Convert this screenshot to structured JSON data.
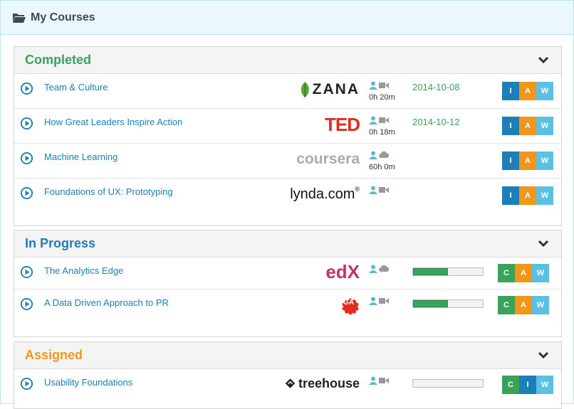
{
  "panel": {
    "title": "My Courses"
  },
  "colors": {
    "completed": "#3aa35b",
    "in_progress": "#1d7fb8",
    "assigned": "#f2961b",
    "link": "#1c7fb6"
  },
  "sections": {
    "completed": {
      "title": "Completed",
      "rows": [
        {
          "name": "Team & Culture",
          "provider": "ZANA",
          "media": [
            "person-icon",
            "video-icon"
          ],
          "duration": "0h 20m",
          "date": "2014-10-08",
          "badges": [
            "I",
            "A",
            "W"
          ]
        },
        {
          "name": "How Great Leaders Inspire Action",
          "provider": "TED",
          "media": [
            "person-icon",
            "video-icon"
          ],
          "duration": "0h 18m",
          "date": "2014-10-12",
          "badges": [
            "I",
            "A",
            "W"
          ]
        },
        {
          "name": "Machine Learning",
          "provider": "coursera",
          "media": [
            "person-icon",
            "cloud-icon"
          ],
          "duration": "60h 0m",
          "date": "",
          "badges": [
            "I",
            "A",
            "W"
          ]
        },
        {
          "name": "Foundations of UX: Prototyping",
          "provider": "lynda.com",
          "provider_mark": "®",
          "media": [
            "person-icon",
            "video-icon"
          ],
          "duration": "",
          "date": "",
          "badges": [
            "I",
            "A",
            "W"
          ]
        }
      ]
    },
    "in_progress": {
      "title": "In Progress",
      "rows": [
        {
          "name": "The Analytics Edge",
          "provider": "edX",
          "media": [
            "person-icon",
            "cloud-icon"
          ],
          "progress": 0.5,
          "badges": [
            "C",
            "A",
            "W"
          ]
        },
        {
          "name": "A Data Driven Approach to PR",
          "provider": "GA",
          "media": [
            "person-icon",
            "video-icon"
          ],
          "progress": 0.5,
          "badges": [
            "C",
            "A",
            "W"
          ]
        }
      ]
    },
    "assigned": {
      "title": "Assigned",
      "rows": [
        {
          "name": "Usability Foundations",
          "provider": "treehouse",
          "media": [
            "person-icon",
            "video-icon"
          ],
          "progress": 0,
          "badges": [
            "C",
            "I",
            "W"
          ]
        }
      ]
    }
  }
}
